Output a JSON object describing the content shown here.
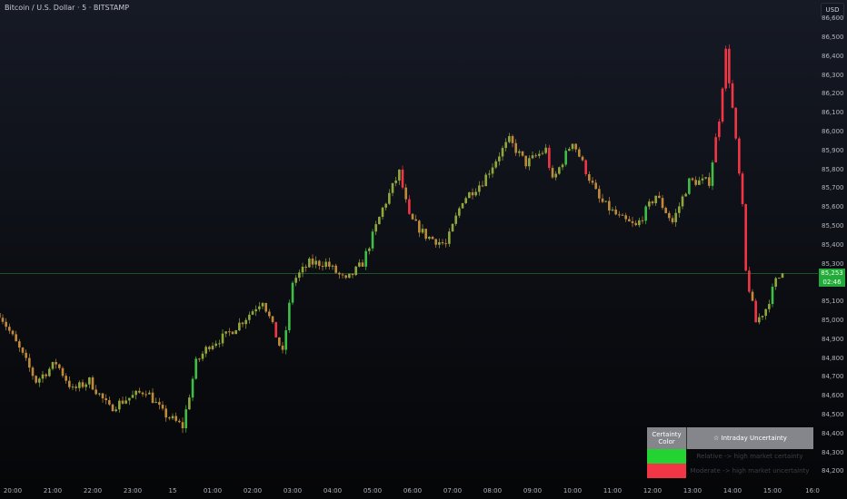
{
  "header": {
    "title": "Bitcoin / U.S. Dollar · 5 · BITSTAMP",
    "currency_button": "USD"
  },
  "price_label": {
    "price": "85,253",
    "countdown": "02:46",
    "color": "#22ab3a"
  },
  "table": {
    "col1": "Certainty Color",
    "col2": "☆ Intraday Uncertainty",
    "rows": [
      {
        "color": "#22d332",
        "text": "Relative -> high market certainty"
      },
      {
        "color": "#f23645",
        "text": "Moderate -> high market uncertainty"
      }
    ]
  },
  "chart_data": {
    "type": "candlestick",
    "yticks": [
      "86,600",
      "86,500",
      "86,400",
      "86,300",
      "86,200",
      "86,100",
      "86,000",
      "85,900",
      "85,800",
      "85,700",
      "85,600",
      "85,500",
      "85,400",
      "85,300",
      "85,200",
      "85,100",
      "85,000",
      "84,900",
      "84,800",
      "84,700",
      "84,600",
      "84,500",
      "84,400",
      "84,300",
      "84,200"
    ],
    "xticks": [
      "20:00",
      "21:00",
      "22:00",
      "23:00",
      "15",
      "01:00",
      "02:00",
      "03:00",
      "04:00",
      "05:00",
      "06:00",
      "07:00",
      "08:00",
      "09:00",
      "10:00",
      "11:00",
      "12:00",
      "13:00",
      "14:00",
      "15:00",
      "16:0"
    ],
    "ylim": [
      84150,
      86650
    ],
    "interval_minutes": 5,
    "last_price": 85253,
    "price_path": [
      [
        "19:40",
        85043
      ],
      [
        "20:10",
        84851
      ],
      [
        "20:35",
        84683
      ],
      [
        "21:05",
        84779
      ],
      [
        "21:30",
        84635
      ],
      [
        "21:55",
        84683
      ],
      [
        "22:25",
        84538
      ],
      [
        "22:50",
        84586
      ],
      [
        "23:20",
        84635
      ],
      [
        "23:45",
        84514
      ],
      [
        "00:15",
        84442
      ],
      [
        "00:35",
        84779
      ],
      [
        "00:55",
        84875
      ],
      [
        "01:20",
        84923
      ],
      [
        "01:50",
        85019
      ],
      [
        "02:15",
        85115
      ],
      [
        "02:30",
        84971
      ],
      [
        "02:45",
        84827
      ],
      [
        "03:00",
        85211
      ],
      [
        "03:25",
        85308
      ],
      [
        "03:50",
        85308
      ],
      [
        "04:20",
        85211
      ],
      [
        "04:45",
        85308
      ],
      [
        "05:15",
        85596
      ],
      [
        "05:40",
        85788
      ],
      [
        "05:55",
        85548
      ],
      [
        "06:20",
        85452
      ],
      [
        "06:50",
        85404
      ],
      [
        "07:15",
        85644
      ],
      [
        "07:45",
        85740
      ],
      [
        "08:10",
        85885
      ],
      [
        "08:25",
        85957
      ],
      [
        "08:50",
        85836
      ],
      [
        "09:20",
        85909
      ],
      [
        "09:30",
        85740
      ],
      [
        "10:00",
        85957
      ],
      [
        "10:15",
        85836
      ],
      [
        "10:40",
        85644
      ],
      [
        "11:10",
        85548
      ],
      [
        "11:35",
        85500
      ],
      [
        "12:05",
        85668
      ],
      [
        "12:30",
        85524
      ],
      [
        "12:55",
        85740
      ],
      [
        "13:25",
        85740
      ],
      [
        "13:40",
        86077
      ],
      [
        "13:50",
        86430
      ],
      [
        "14:00",
        86125
      ],
      [
        "14:15",
        85596
      ],
      [
        "14:20",
        85260
      ],
      [
        "14:35",
        84995
      ],
      [
        "14:50",
        85067
      ],
      [
        "15:05",
        85211
      ],
      [
        "15:15",
        85253
      ]
    ],
    "colors": {
      "up": "#8fa83c",
      "down": "#c08a3a",
      "strong_down": "#f23645",
      "strong_up": "#3fbf45"
    }
  }
}
